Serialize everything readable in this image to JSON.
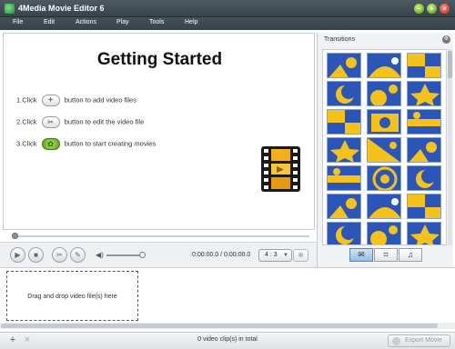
{
  "window": {
    "title": "4Media Movie Editor 6"
  },
  "menu": [
    "File",
    "Edit",
    "Actions",
    "Play",
    "Tools",
    "Help"
  ],
  "preview": {
    "heading": "Getting Started",
    "steps": [
      {
        "prefix": "1.Click",
        "suffix": "button to add video files",
        "icon": "plus-icon"
      },
      {
        "prefix": "2.Click",
        "suffix": "button to edit the video file",
        "icon": "scissors-icon"
      },
      {
        "prefix": "3.Click",
        "suffix": "button to start creating movies",
        "icon": "film-reel-icon"
      }
    ]
  },
  "player": {
    "time": "0:00:00.0 / 0:00:00.0",
    "aspect_ratio": "4 : 3",
    "volume_fraction": 0.85,
    "seek_fraction": 0.0
  },
  "transitions": {
    "label": "Transitions",
    "tabs": [
      "transition-icon",
      "crop-icon",
      "music-icon"
    ]
  },
  "storyboard": {
    "drop_hint": "Drag and drop video file(s) here"
  },
  "status": {
    "clip_count": "0 video clip(s) in total",
    "export_label": "Export Movie"
  },
  "colors": {
    "titlebar": "#3f4a52",
    "tile_blue": "#2b56b8",
    "tile_yellow": "#f4c21a"
  }
}
